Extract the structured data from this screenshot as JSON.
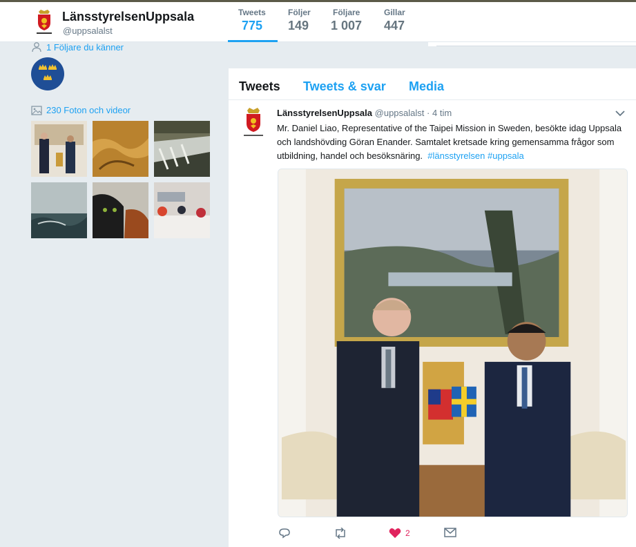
{
  "profile": {
    "name": "LänsstyrelsenUppsala",
    "handle": "@uppsalalst"
  },
  "stats": [
    {
      "label": "Tweets",
      "value": "775",
      "active": true
    },
    {
      "label": "Följer",
      "value": "149",
      "active": false
    },
    {
      "label": "Följare",
      "value": "1 007",
      "active": false
    },
    {
      "label": "Gillar",
      "value": "447",
      "active": false
    }
  ],
  "sidebar": {
    "followers_known": "1 Följare du känner",
    "photos_label": "230 Foton och videor"
  },
  "tabs": [
    {
      "label": "Tweets",
      "active": true
    },
    {
      "label": "Tweets & svar",
      "active": false
    },
    {
      "label": "Media",
      "active": false
    }
  ],
  "tweet": {
    "name": "LänsstyrelsenUppsala",
    "handle": "@uppsalalst",
    "separator": "·",
    "time": "4 tim",
    "text": "Mr. Daniel Liao, Representative of the Taipei Mission in Sweden, besökte idag Uppsala och landshövding Göran Enander. Samtalet kretsade kring gemensamma frågor som utbildning, handel och besöksnäring.",
    "hashtags": [
      "#länsstyrelsen",
      "#uppsala"
    ],
    "actions": {
      "reply": "",
      "retweet": "",
      "like": "2",
      "message": ""
    }
  },
  "icons": {
    "reply": "reply-icon",
    "retweet": "retweet-icon",
    "like": "heart-icon",
    "message": "envelope-icon",
    "chevron": "chevron-down-icon"
  },
  "colors": {
    "accent": "#1da1f2",
    "like": "#e0245e",
    "background": "#e6ecf0"
  }
}
